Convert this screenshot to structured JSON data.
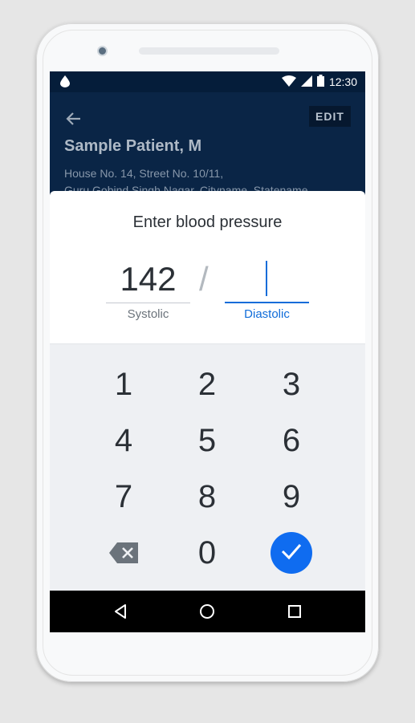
{
  "status_bar": {
    "time": "12:30",
    "icons": [
      "drop-icon",
      "wifi-icon",
      "signal-icon",
      "battery-icon"
    ]
  },
  "header": {
    "edit_label": "EDIT",
    "patient_name": "Sample Patient, M",
    "address_line1": "House No. 14, Street No. 10/11,",
    "address_line2": "Guru Gobind Singh Nagar, Cityname, Statename"
  },
  "dialog": {
    "title": "Enter blood pressure",
    "separator": "/",
    "systolic": {
      "value": "142",
      "label": "Systolic"
    },
    "diastolic": {
      "value": "",
      "label": "Diastolic"
    }
  },
  "keypad": {
    "keys": [
      "1",
      "2",
      "3",
      "4",
      "5",
      "6",
      "7",
      "8",
      "9",
      "0"
    ],
    "delete_icon": "backspace-icon",
    "done_icon": "check-icon"
  },
  "colors": {
    "accent": "#0f6cf0",
    "header_bg": "#0a2546",
    "status_bg": "#051d3a",
    "keypad_bg": "#eef0f3"
  },
  "nav_bar": {
    "icons": [
      "back-triangle-icon",
      "home-circle-icon",
      "recents-square-icon"
    ]
  }
}
